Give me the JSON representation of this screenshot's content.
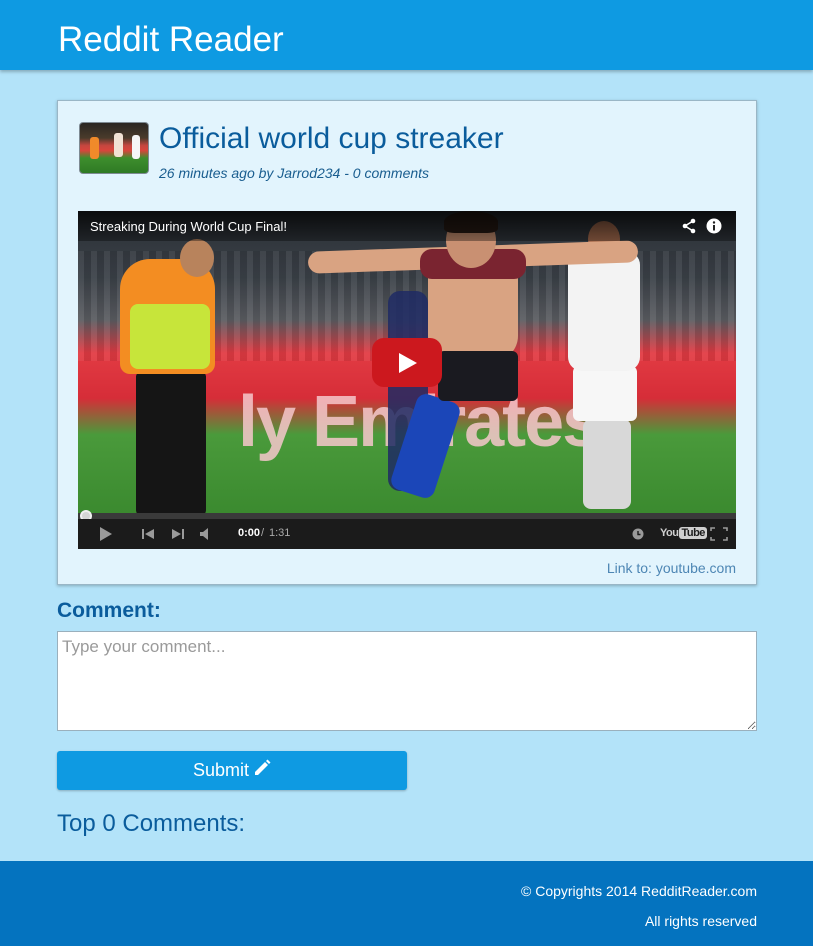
{
  "header": {
    "title": "Reddit Reader"
  },
  "post": {
    "title": "Official world cup streaker",
    "meta": "26 minutes ago by Jarrod234 - 0 comments",
    "link_text": "Link to: youtube.com"
  },
  "video": {
    "title": "Streaking During World Cup Final!",
    "time_current": "0:00",
    "time_separator": "/",
    "time_total": "1:31",
    "banner_text": "ly Emirates",
    "progress_fraction": 0,
    "logo_you": "You",
    "logo_tube": "Tube"
  },
  "comment": {
    "label": "Comment:",
    "placeholder": "Type your comment...",
    "submit_label": "Submit"
  },
  "comments_section": {
    "heading": "Top 0 Comments:"
  },
  "footer": {
    "copyright": "© Copyrights 2014 RedditReader.com",
    "rights": "All rights reserved"
  },
  "colors": {
    "header_bg": "#0e9ae2",
    "page_bg": "#b3e3f9",
    "card_bg": "#e2f4fd",
    "title_blue": "#0a5c9c",
    "footer_bg": "#0473bf",
    "play_red": "#cc181e"
  },
  "icons": {
    "share": "share-icon",
    "info": "info-icon",
    "pencil": "pencil-icon",
    "play": "play-icon"
  }
}
